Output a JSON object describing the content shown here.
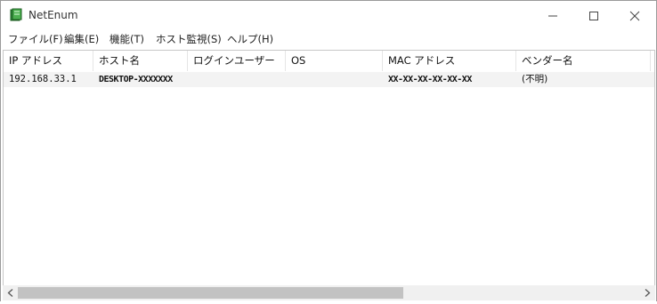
{
  "window": {
    "title": "NetEnum",
    "app_icon": "book-green-icon"
  },
  "controls": {
    "minimize_icon": "minimize-icon",
    "maximize_icon": "maximize-icon",
    "close_icon": "close-icon"
  },
  "menu": {
    "items": [
      "ファイル(F)",
      "編集(E)",
      "機能(T)",
      "ホスト監視(S)",
      "ヘルプ(H)"
    ]
  },
  "table": {
    "columns": [
      "IP アドレス",
      "ホスト名",
      "ログインユーザー",
      "OS",
      "MAC アドレス",
      "ベンダー名"
    ],
    "rows": [
      {
        "ip": "192.168.33.1",
        "host": "DESKTOP-XXXXXXX",
        "user": "",
        "os": "",
        "mac": "XX-XX-XX-XX-XX-XX",
        "vendor": "(不明)"
      }
    ]
  },
  "scrollbar": {
    "left_icon": "chevron-left-icon",
    "right_icon": "chevron-right-icon"
  },
  "colors": {
    "row_highlight": "#f3f3f3",
    "scroll_thumb": "#c2c2c2",
    "window_border": "#9a9a9a"
  }
}
